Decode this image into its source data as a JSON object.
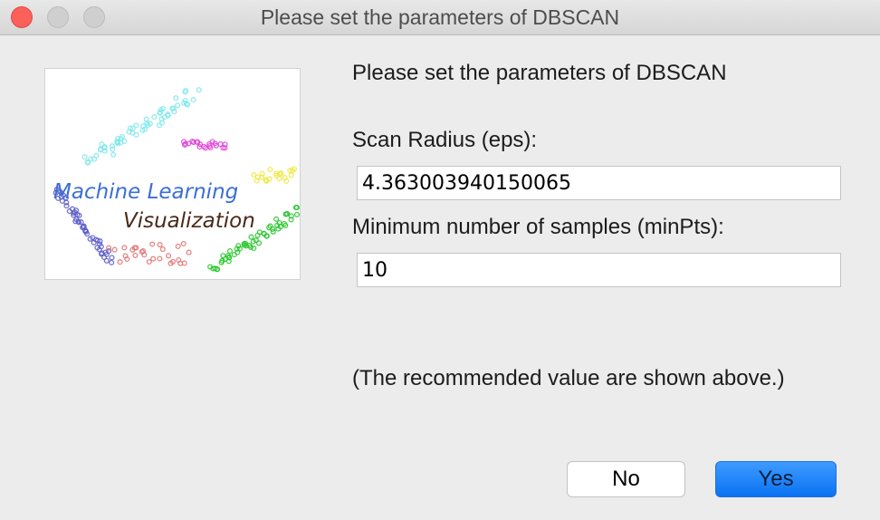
{
  "window": {
    "title": "Please set the parameters of DBSCAN"
  },
  "logo": {
    "line1": "Machine Learning",
    "line2": "Visualization",
    "colors": {
      "line1": "#3b6fd6",
      "line2": "#4a2a18",
      "clusters": [
        "#7fe8ea",
        "#e040d8",
        "#f0e83a",
        "#22c626",
        "#5a5ac8",
        "#e07070"
      ]
    }
  },
  "form": {
    "heading": "Please set the parameters of DBSCAN",
    "eps_label": "Scan Radius (eps):",
    "eps_value": "4.363003940150065",
    "minpts_label": "Minimum number of samples (minPts):",
    "minpts_value": "10",
    "note": "(The recommended value are shown above.)"
  },
  "buttons": {
    "no": "No",
    "yes": "Yes"
  },
  "colors": {
    "close": "#fc605b",
    "accent": "#0a73f3",
    "window_bg": "#ececec"
  }
}
